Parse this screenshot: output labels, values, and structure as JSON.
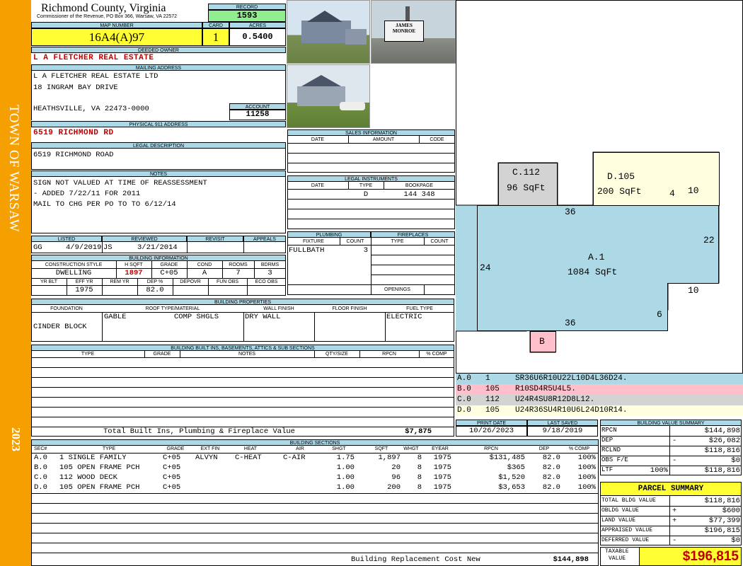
{
  "sidebar": {
    "town": "TOWN OF WARSAW",
    "year": "2023"
  },
  "header": {
    "county": "Richmond County, Virginia",
    "commissioner": "Commissioner of the Revenue, PO Box 366, Warsaw, VA 22572",
    "record_label": "RECORD",
    "record_value": "1593",
    "map_label": "MAP NUMBER",
    "map_value": "16A4(A)97",
    "card_label": "CARD",
    "card_value": "1",
    "acres_label": "ACRES",
    "acres_value": "0.5400"
  },
  "owner": {
    "label": "DEEDED OWNER",
    "value": "L A FLETCHER REAL ESTATE"
  },
  "mailing": {
    "label": "MAILING ADDRESS",
    "line1": "L A FLETCHER REAL ESTATE LTD",
    "line2": "18 INGRAM BAY DRIVE",
    "line3": "HEATHSVILLE, VA 22473-0000",
    "account_label": "ACCOUNT",
    "account_value": "11258"
  },
  "physical": {
    "label": "PHYSICAL 911 ADDRESS",
    "value": "6519 RICHMOND RD"
  },
  "legal": {
    "label": "LEGAL DESCRIPTION",
    "value": "6519 RICHMOND ROAD"
  },
  "notes": {
    "label": "NOTES",
    "line1": "SIGN NOT VALUED AT TIME OF REASSESSMENT",
    "line2": "- ADDED 7/22/11 FOR 2011",
    "line3": "MAIL TO CHG PER PO TO TO 6/12/14"
  },
  "review": {
    "listed_label": "LISTED",
    "reviewed_label": "REVIEWED",
    "revisit_label": "REVISIT",
    "appeals_label": "APPEALS",
    "listed_by": "GG",
    "listed_date": "4/9/2019",
    "reviewed_by": "JS",
    "reviewed_date": "3/21/2014"
  },
  "building_info": {
    "label": "BUILDING INFORMATION",
    "h_style": "CONSTRUCTION STYLE",
    "h_sqft": "H SQFT",
    "h_grade": "GRADE",
    "h_cond": "COND",
    "h_rooms": "ROOMS",
    "h_bdrms": "BDRMS",
    "style": "DWELLING",
    "sqft": "1897",
    "grade": "C+05",
    "cond": "A",
    "rooms": "7",
    "bdrms": "3",
    "h_yrblt": "YR BLT",
    "h_effyr": "EFF YR",
    "h_remyr": "REM YR",
    "h_dep": "DEP %",
    "h_depovr": "DEPOVR",
    "h_funobs": "FUN OBS",
    "h_ecoobs": "ECO OBS",
    "effyr": "1975",
    "dep": "82.0"
  },
  "sales": {
    "label": "SALES INFORMATION",
    "h_date": "DATE",
    "h_amount": "AMOUNT",
    "h_code": "CODE"
  },
  "instruments": {
    "label": "LEGAL INSTRUMENTS",
    "h_date": "DATE",
    "h_type": "TYPE",
    "h_book": "BOOKPAGE",
    "type": "D",
    "book": "144 348"
  },
  "plumbing": {
    "label": "PLUMBING",
    "h_fixture": "FIXTURE",
    "h_count": "COUNT",
    "fixture": "FULLBATH",
    "count": "3"
  },
  "fireplaces": {
    "label": "FIREPLACES",
    "h_type": "TYPE",
    "h_count": "COUNT",
    "openings": "OPENINGS"
  },
  "properties": {
    "label": "BUILDING PROPERTIES",
    "h_foundation": "FOUNDATION",
    "h_roof": "ROOF TYPE/MATERIAL",
    "h_wall": "WALL FINISH",
    "h_floor": "FLOOR FINISH",
    "h_fuel": "FUEL TYPE",
    "foundation": "CINDER BLOCK",
    "roof_type": "GABLE",
    "roof_mat": "COMP SHGLS",
    "wall": "DRY WALL",
    "fuel": "ELECTRIC"
  },
  "builtins": {
    "label": "BUILDING BUILT INS, BASEMENTS, ATTICS & SUB SECTIONS",
    "h_type": "TYPE",
    "h_grade": "GRADE",
    "h_notes": "NOTES",
    "h_qty": "QTY/SIZE",
    "h_rpcn": "RPCN",
    "h_comp": "% COMP",
    "total_label": "Total Built Ins, Plumbing & Fireplace Value",
    "total_value": "$7,875"
  },
  "dates": {
    "print_label": "PRINT DATE",
    "saved_label": "LAST SAVED",
    "print_value": "10/26/2023",
    "saved_value": "9/18/2019"
  },
  "sections": {
    "label": "BUILDING SECTIONS",
    "headers": [
      "SEC#",
      "TYPE",
      "GRADE",
      "EXT FIN",
      "HEAT",
      "AIR",
      "SHGT",
      "SQFT",
      "WHGT",
      "EYEAR",
      "RPCN",
      "DEP",
      "% COMP"
    ],
    "rows": [
      [
        "A.0",
        "1 SINGLE FAMILY",
        "C+05",
        "ALVYN",
        "C-HEAT",
        "C-AIR",
        "1.75",
        "1,897",
        "8",
        "1975",
        "$131,485",
        "82.0",
        "100%"
      ],
      [
        "B.0",
        "105 OPEN FRAME PCH",
        "C+05",
        "",
        "",
        "",
        "1.00",
        "20",
        "8",
        "1975",
        "$365",
        "82.0",
        "100%"
      ],
      [
        "C.0",
        "112 WOOD DECK",
        "C+05",
        "",
        "",
        "",
        "1.00",
        "96",
        "8",
        "1975",
        "$1,520",
        "82.0",
        "100%"
      ],
      [
        "D.0",
        "105 OPEN FRAME PCH",
        "C+05",
        "",
        "",
        "",
        "1.00",
        "200",
        "8",
        "1975",
        "$3,653",
        "82.0",
        "100%"
      ]
    ],
    "cost_label": "Building Replacement Cost New",
    "cost_value": "$144,898"
  },
  "sketch": {
    "c_label": "C.112",
    "c_area": "96 SqFt",
    "d_label": "D.105",
    "d_area": "200 SqFt",
    "a_label": "A.1",
    "a_area": "1084 SqFt",
    "b_label": "B",
    "dims": {
      "d36top": "36",
      "d4": "4",
      "d10top": "10",
      "d22": "22",
      "d24": "24",
      "d10r": "10",
      "d6": "6",
      "d36bot": "36"
    },
    "colors": {
      "a": "#add8e6",
      "b": "#ffc0cb",
      "c": "#d3d3d3",
      "d": "#ffffe0"
    }
  },
  "traverse": [
    {
      "sec": "A.0",
      "code": "1",
      "path": "SR36U6R10U22L10D4L36D24.",
      "color": "#add8e6"
    },
    {
      "sec": "B.0",
      "code": "105",
      "path": "R10SD4R5U4L5.",
      "color": "#ffc0cb"
    },
    {
      "sec": "C.0",
      "code": "112",
      "path": "U24R4SU8R12D8L12.",
      "color": "#d3d3d3"
    },
    {
      "sec": "D.0",
      "code": "105",
      "path": "U24R36SU4R10U6L24D10R14.",
      "color": "#ffffe0"
    }
  ],
  "value_summary": {
    "label": "BUILDING VALUE SUMMARY",
    "rpcn_label": "RPCN",
    "rpcn": "$144,898",
    "dep_label": "DEP",
    "dep_sign": "-",
    "dep": "$26,082",
    "rclnd_label": "RCLND",
    "rclnd": "$118,816",
    "obs_label": "OBS F/E",
    "obs_sign": "-",
    "obs": "$0",
    "ltf_label": "LTF",
    "ltf_pct": "100%",
    "ltf": "$118,816"
  },
  "parcel": {
    "title": "PARCEL SUMMARY",
    "total_bldg_label": "TOTAL BLDG VALUE",
    "total_bldg": "$118,816",
    "obldg_label": "OBLDG VALUE",
    "obldg_sign": "+",
    "obldg": "$600",
    "land_label": "LAND VALUE",
    "land_sign": "+",
    "land": "$77,399",
    "appraised_label": "APPRAISED VALUE",
    "appraised": "$196,815",
    "deferred_label": "DEFERRED VALUE",
    "deferred_sign": "-",
    "deferred": "$0",
    "taxable_label1": "TAXABLE",
    "taxable_label2": "VALUE",
    "taxable": "$196,815"
  },
  "photos": {
    "sign1": "JAMES",
    "sign2": "MONROE"
  }
}
